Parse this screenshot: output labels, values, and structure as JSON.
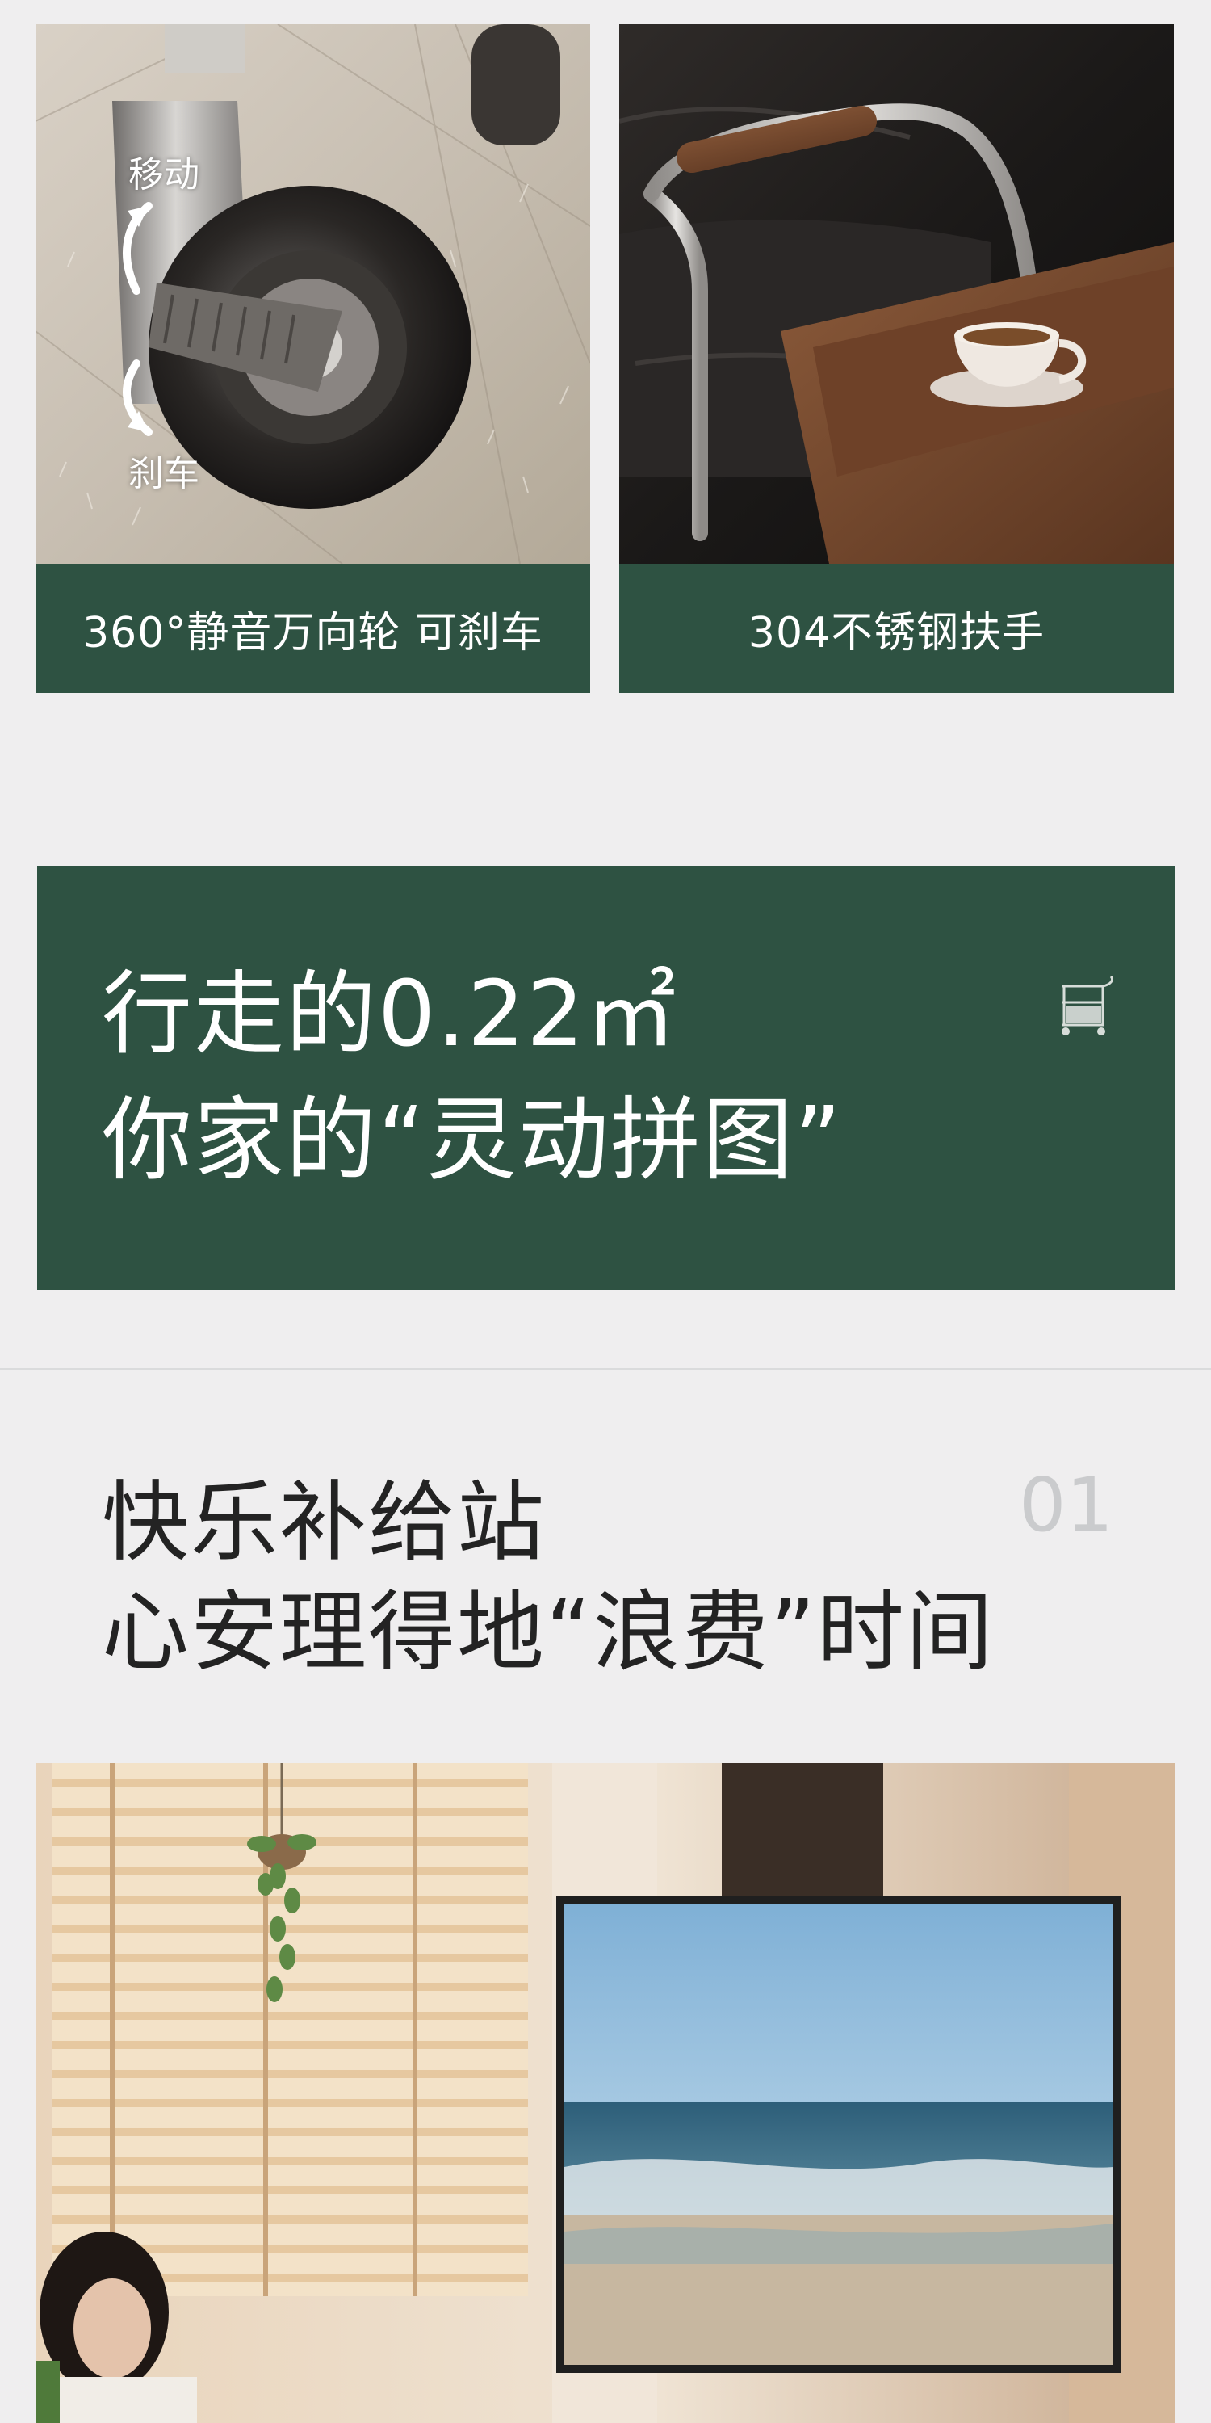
{
  "features": [
    {
      "caption": "360°静音万向轮 可刹车",
      "labels": {
        "move": "移动",
        "brake": "刹车"
      }
    },
    {
      "caption": "304不锈钢扶手"
    }
  ],
  "banner": {
    "line1": "行走的0.22㎡",
    "line2": "你家的“灵动拼图”"
  },
  "section": {
    "number": "01",
    "title_line1": "快乐补给站",
    "title_line2": "心安理得地“浪费”时间"
  },
  "icons": {
    "banner_icon": "cart-icon"
  },
  "colors": {
    "accent_green": "#2e5242",
    "background": "#efeeef",
    "text_dark": "#232323",
    "number_gray": "#cacbcd"
  }
}
